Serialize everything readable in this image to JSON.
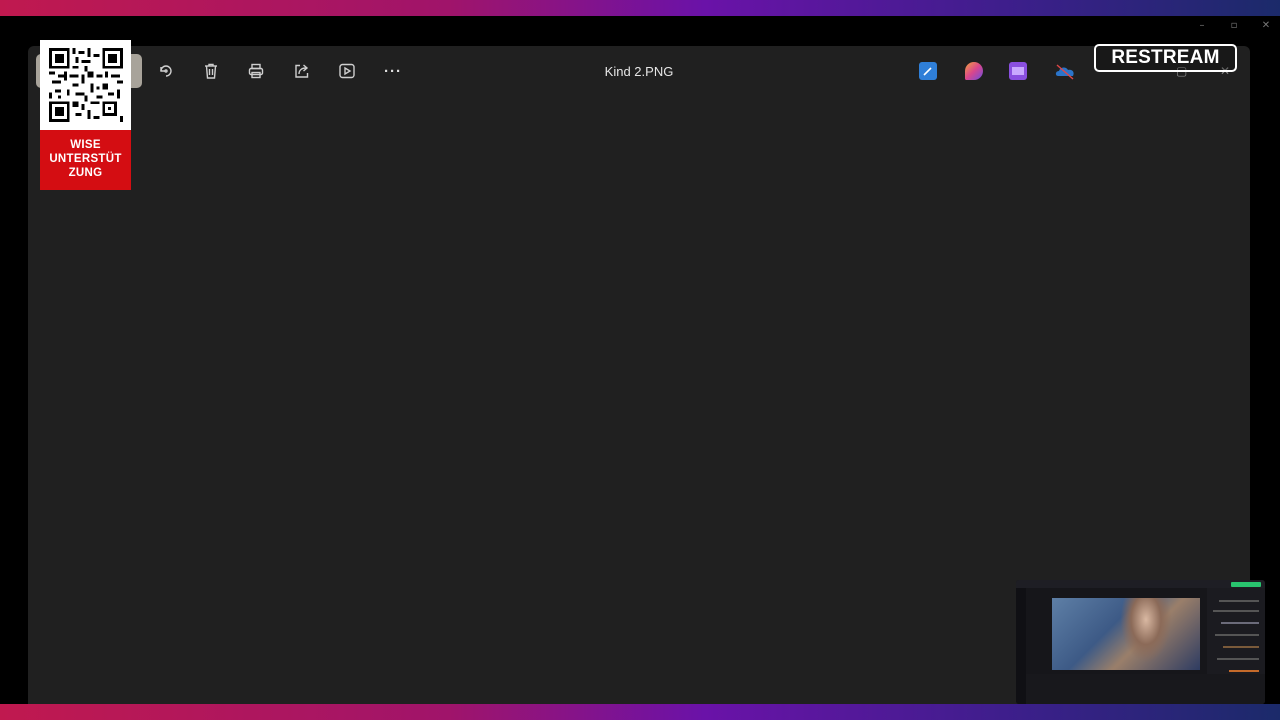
{
  "viewer": {
    "file_name": "Kind 2.PNG",
    "toolbar": [
      {
        "name": "rotate-icon"
      },
      {
        "name": "delete-icon"
      },
      {
        "name": "print-icon"
      },
      {
        "name": "share-icon"
      },
      {
        "name": "slideshow-icon"
      },
      {
        "name": "more-options-icon"
      }
    ],
    "apps": [
      {
        "name": "edit-app-icon",
        "color": "#2f7fd8"
      },
      {
        "name": "clipchamp-app-icon",
        "color": "#d9468d"
      },
      {
        "name": "video-editor-app-icon",
        "color": "#8a4fe0"
      },
      {
        "name": "onedrive-icon",
        "color": "#2b74c9"
      }
    ],
    "more_label": "···",
    "win_controls": {
      "minimize": "—",
      "maximize": "▢",
      "close": "✕"
    }
  },
  "outer_window": {
    "minimize": "–",
    "maximize": "▫",
    "close": "✕"
  },
  "overlay": {
    "qr_text": "WISE UNTERSTÜT ZUNG",
    "brand": "RESTREAM"
  },
  "colors": {
    "accent_red": "#d40d12",
    "window_bg": "#202020"
  }
}
